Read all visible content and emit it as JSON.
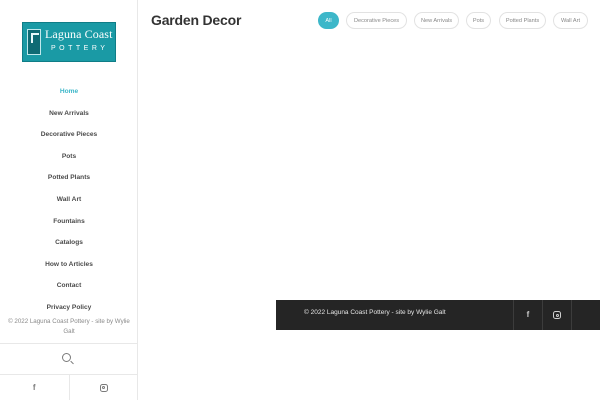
{
  "brand": {
    "logo_line1": "Laguna Coast",
    "logo_line2": "POTTERY"
  },
  "sidebar": {
    "items": [
      {
        "label": "Home",
        "active": true
      },
      {
        "label": "New Arrivals"
      },
      {
        "label": "Decorative Pieces"
      },
      {
        "label": "Pots"
      },
      {
        "label": "Potted Plants"
      },
      {
        "label": "Wall Art"
      },
      {
        "label": "Fountains"
      },
      {
        "label": "Catalogs"
      },
      {
        "label": "How to Articles"
      },
      {
        "label": "Contact"
      },
      {
        "label": "Privacy Policy"
      }
    ],
    "copyright": "© 2022 Laguna Coast Pottery - site by Wylie Galt",
    "search_icon": "search-icon",
    "social": [
      "facebook-icon",
      "instagram-icon"
    ]
  },
  "main": {
    "title": "Garden Decor",
    "filters": [
      {
        "label": "All",
        "active": true
      },
      {
        "label": "Decorative Pieces"
      },
      {
        "label": "New Arrivals"
      },
      {
        "label": "Pots"
      },
      {
        "label": "Potted Plants"
      },
      {
        "label": "Wall Art"
      }
    ]
  },
  "footer": {
    "copyright": "© 2022 Laguna Coast Pottery - site by Wylie Galt",
    "facebook_glyph": "f",
    "social": [
      "facebook-icon",
      "instagram-icon"
    ]
  },
  "colors": {
    "accent": "#3db7c9",
    "logo_bg": "#1a9aa5",
    "footer_bg": "#252525"
  }
}
